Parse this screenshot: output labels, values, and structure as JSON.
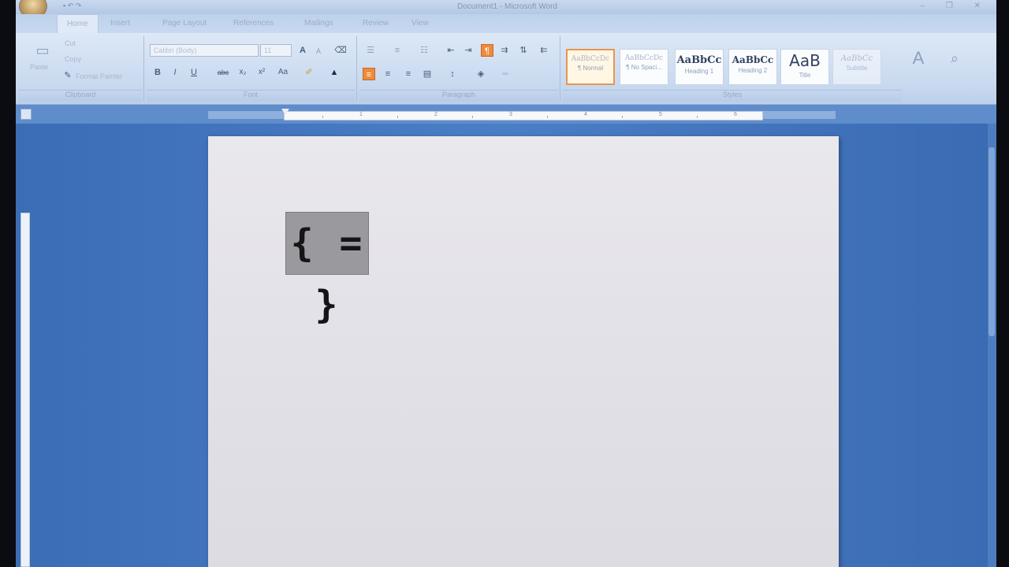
{
  "window": {
    "title": "Document1 - Microsoft Word",
    "controls": "– ❐ ✕"
  },
  "tabs": [
    {
      "label": "Home",
      "active": true
    },
    {
      "label": "Insert"
    },
    {
      "label": "Page Layout"
    },
    {
      "label": "References"
    },
    {
      "label": "Mailings"
    },
    {
      "label": "Review"
    },
    {
      "label": "View"
    }
  ],
  "ribbon": {
    "clipboard": {
      "paste_label": "Paste",
      "cut_label": "Cut",
      "copy_label": "Copy",
      "format_painter_label": "Format Painter",
      "group_label": "Clipboard"
    },
    "font": {
      "font_name": "Calibri (Body)",
      "font_size": "11",
      "group_label": "Font",
      "bold": "B",
      "italic": "I",
      "underline": "U",
      "strike": "abc",
      "subscript": "x₂",
      "superscript": "x²",
      "change_case": "Aa",
      "grow": "A",
      "shrink": "A"
    },
    "paragraph": {
      "group_label": "Paragraph"
    },
    "styles": {
      "group_label": "Styles",
      "items": [
        {
          "sample": "AaBbCcDc",
          "name": "¶ Normal",
          "selected": true
        },
        {
          "sample": "AaBbCcDc",
          "name": "¶ No Spaci..."
        },
        {
          "sample": "AaBbCc",
          "name": "Heading 1"
        },
        {
          "sample": "AaBbCc",
          "name": "Heading 2"
        },
        {
          "sample": "AaB",
          "name": "Title"
        },
        {
          "sample": "AaBbCc",
          "name": "Subtitle"
        }
      ]
    }
  },
  "ruler": {
    "numbers": [
      "1",
      "2",
      "3",
      "4",
      "5",
      "6"
    ]
  },
  "document": {
    "field_code": "{ = }"
  }
}
